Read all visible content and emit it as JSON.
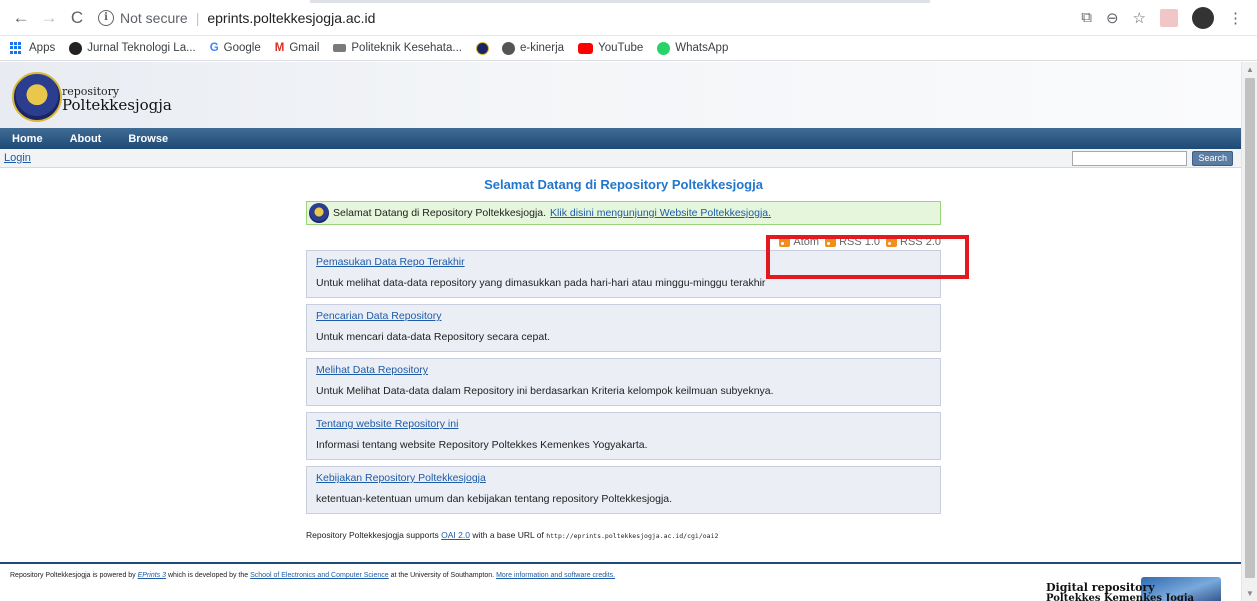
{
  "browser": {
    "url_status": "Not secure",
    "url": "eprints.poltekkesjogja.ac.id",
    "icons": [
      "back-icon",
      "forward-icon",
      "reload-icon",
      "info-icon",
      "translate-icon",
      "zoom-icon",
      "star-icon",
      "pdf-icon",
      "profile-avatar",
      "kebab-menu-icon"
    ]
  },
  "bookmarks": [
    {
      "label": "Apps",
      "icon": "apps-grid-icon"
    },
    {
      "label": "Jurnal Teknologi La...",
      "icon": "jurnal-icon"
    },
    {
      "label": "Google",
      "icon": "google-icon"
    },
    {
      "label": "Gmail",
      "icon": "gmail-icon"
    },
    {
      "label": "Politeknik Kesehata...",
      "icon": "poltekkes-icon"
    },
    {
      "label": "",
      "icon": "emblem-icon"
    },
    {
      "label": "e-kinerja",
      "icon": "globe-icon"
    },
    {
      "label": "YouTube",
      "icon": "youtube-icon"
    },
    {
      "label": "WhatsApp",
      "icon": "whatsapp-icon"
    }
  ],
  "site": {
    "name_small": "repository",
    "name_big": "Poltekkesjogja",
    "menu": [
      "Home",
      "About",
      "Browse"
    ],
    "login": "Login",
    "search_button": "Search"
  },
  "main": {
    "title": "Selamat Datang di Repository Poltekkesjogja",
    "welcome_text": "Selamat Datang di Repository Poltekkesjogja.",
    "welcome_link": "Klik disini mengunjungi Website Poltekkesjogja.",
    "feeds": [
      "Atom",
      "RSS 1.0",
      "RSS 2.0"
    ],
    "panels": [
      {
        "link": "Pemasukan Data Repo Terakhir",
        "desc": "Untuk melihat data-data repository yang dimasukkan pada hari-hari atau minggu-minggu terakhir"
      },
      {
        "link": "Pencarian Data Repository",
        "desc": "Untuk mencari data-data Repository secara cepat."
      },
      {
        "link": "Melihat Data Repository",
        "desc": "Untuk Melihat Data-data dalam Repository ini berdasarkan Kriteria kelompok keilmuan subyeknya."
      },
      {
        "link": "Tentang website Repository ini",
        "desc": "Informasi tentang website Repository Poltekkes Kemenkes Yogyakarta."
      },
      {
        "link": "Kebijakan Repository Poltekkesjogja",
        "desc": "ketentuan-ketentuan umum dan kebijakan tentang repository Poltekkesjogja."
      }
    ],
    "oai_prefix": "Repository Poltekkesjogja supports",
    "oai_link": "OAI 2.0",
    "oai_middle": "with a base URL of",
    "oai_url": "http://eprints.poltekkesjogja.ac.id/cgi/oai2"
  },
  "footer": {
    "p1": "Repository Poltekkesjogja is powered by",
    "eprints_link": "EPrints 3",
    "p2": "which is developed by the",
    "school_link": "School of Electronics and Computer Science",
    "p3": "at the University of Southampton.",
    "credits_link": "More information and software credits.",
    "digital_line1": "Digital repository",
    "digital_line2": "Poltekkes Kemenkes Jogja"
  },
  "colors": {
    "menubar": "#1e4a76",
    "link": "#1d5ca8",
    "title": "#2277cc",
    "welcome_bg": "#e6f6dc",
    "panel_bg": "#eceef6",
    "highlight_box": "#e2191f",
    "rss": "#f28e1b"
  }
}
